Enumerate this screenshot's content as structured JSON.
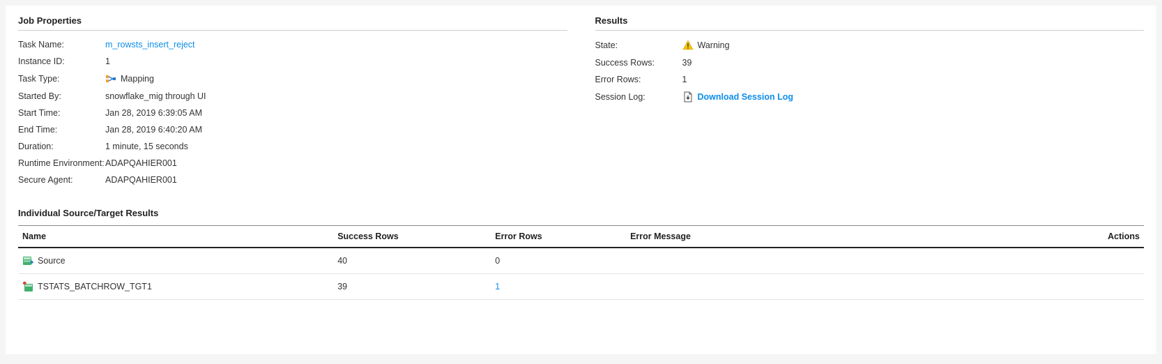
{
  "jobProperties": {
    "title": "Job Properties",
    "fields": {
      "taskNameLabel": "Task Name:",
      "taskName": "m_rowsts_insert_reject",
      "instanceIdLabel": "Instance ID:",
      "instanceId": "1",
      "taskTypeLabel": "Task Type:",
      "taskType": "Mapping",
      "startedByLabel": "Started By:",
      "startedBy": "snowflake_mig through UI",
      "startTimeLabel": "Start Time:",
      "startTime": "Jan 28, 2019 6:39:05 AM",
      "endTimeLabel": "End Time:",
      "endTime": "Jan 28, 2019 6:40:20 AM",
      "durationLabel": "Duration:",
      "duration": "1 minute, 15 seconds",
      "runtimeEnvLabel": "Runtime Environment:",
      "runtimeEnv": "ADAPQAHIER001",
      "secureAgentLabel": "Secure Agent:",
      "secureAgent": "ADAPQAHIER001"
    }
  },
  "results": {
    "title": "Results",
    "fields": {
      "stateLabel": "State:",
      "state": "Warning",
      "successRowsLabel": "Success Rows:",
      "successRows": "39",
      "errorRowsLabel": "Error Rows:",
      "errorRows": "1",
      "sessionLogLabel": "Session Log:",
      "sessionLogLink": "Download Session Log"
    }
  },
  "individual": {
    "title": "Individual Source/Target Results",
    "headers": {
      "name": "Name",
      "successRows": "Success Rows",
      "errorRows": "Error Rows",
      "errorMessage": "Error Message",
      "actions": "Actions"
    },
    "rows": [
      {
        "icon": "source",
        "name": "Source",
        "successRows": "40",
        "errorRows": "0",
        "errorRowsLink": false,
        "errorMessage": ""
      },
      {
        "icon": "target",
        "name": "TSTATS_BATCHROW_TGT1",
        "successRows": "39",
        "errorRows": "1",
        "errorRowsLink": true,
        "errorMessage": ""
      }
    ]
  }
}
